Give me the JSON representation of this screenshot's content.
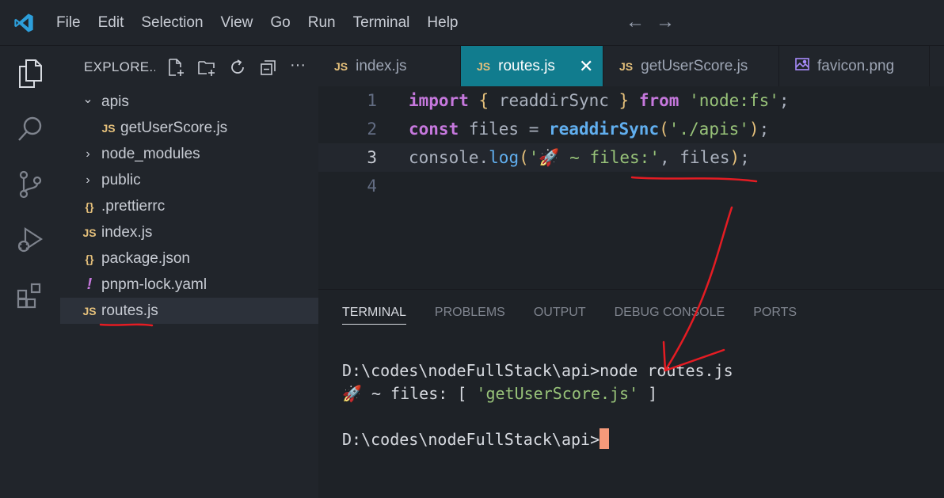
{
  "menu": [
    "File",
    "Edit",
    "Selection",
    "View",
    "Go",
    "Run",
    "Terminal",
    "Help"
  ],
  "explorer": {
    "title": "EXPLORE...",
    "tree": [
      {
        "type": "folder",
        "open": true,
        "label": "apis",
        "indent": 0
      },
      {
        "type": "js",
        "label": "getUserScore.js",
        "indent": 1
      },
      {
        "type": "folder",
        "open": false,
        "label": "node_modules",
        "indent": 0
      },
      {
        "type": "folder",
        "open": false,
        "label": "public",
        "indent": 0
      },
      {
        "type": "json",
        "label": ".prettierrc",
        "indent": 0
      },
      {
        "type": "js",
        "label": "index.js",
        "indent": 0
      },
      {
        "type": "json",
        "label": "package.json",
        "indent": 0
      },
      {
        "type": "yaml",
        "label": "pnpm-lock.yaml",
        "indent": 0
      },
      {
        "type": "js",
        "label": "routes.js",
        "indent": 0,
        "active": true
      }
    ]
  },
  "tabs": [
    {
      "label": "index.js",
      "icon": "JS",
      "active": false
    },
    {
      "label": "routes.js",
      "icon": "JS",
      "active": true
    },
    {
      "label": "getUserScore.js",
      "icon": "JS",
      "active": false
    },
    {
      "label": "favicon.png",
      "icon": "image",
      "active": false
    }
  ],
  "editor": {
    "line_numbers": [
      "1",
      "2",
      "3",
      "4"
    ],
    "current_line": 3
  },
  "panel": {
    "tabs": [
      "TERMINAL",
      "PROBLEMS",
      "OUTPUT",
      "DEBUG CONSOLE",
      "PORTS"
    ],
    "active_tab": "TERMINAL",
    "terminal": {
      "line1": "D:\\codes\\nodeFullStack\\api>node routes.js",
      "line2_prefix": "🚀 ~ files: [ ",
      "line2_string": "'getUserScore.js'",
      "line2_suffix": " ]",
      "line3": "D:\\codes\\nodeFullStack\\api>"
    }
  },
  "colors": {
    "accent_tab": "#117c8e",
    "annotation": "#e51c23"
  }
}
